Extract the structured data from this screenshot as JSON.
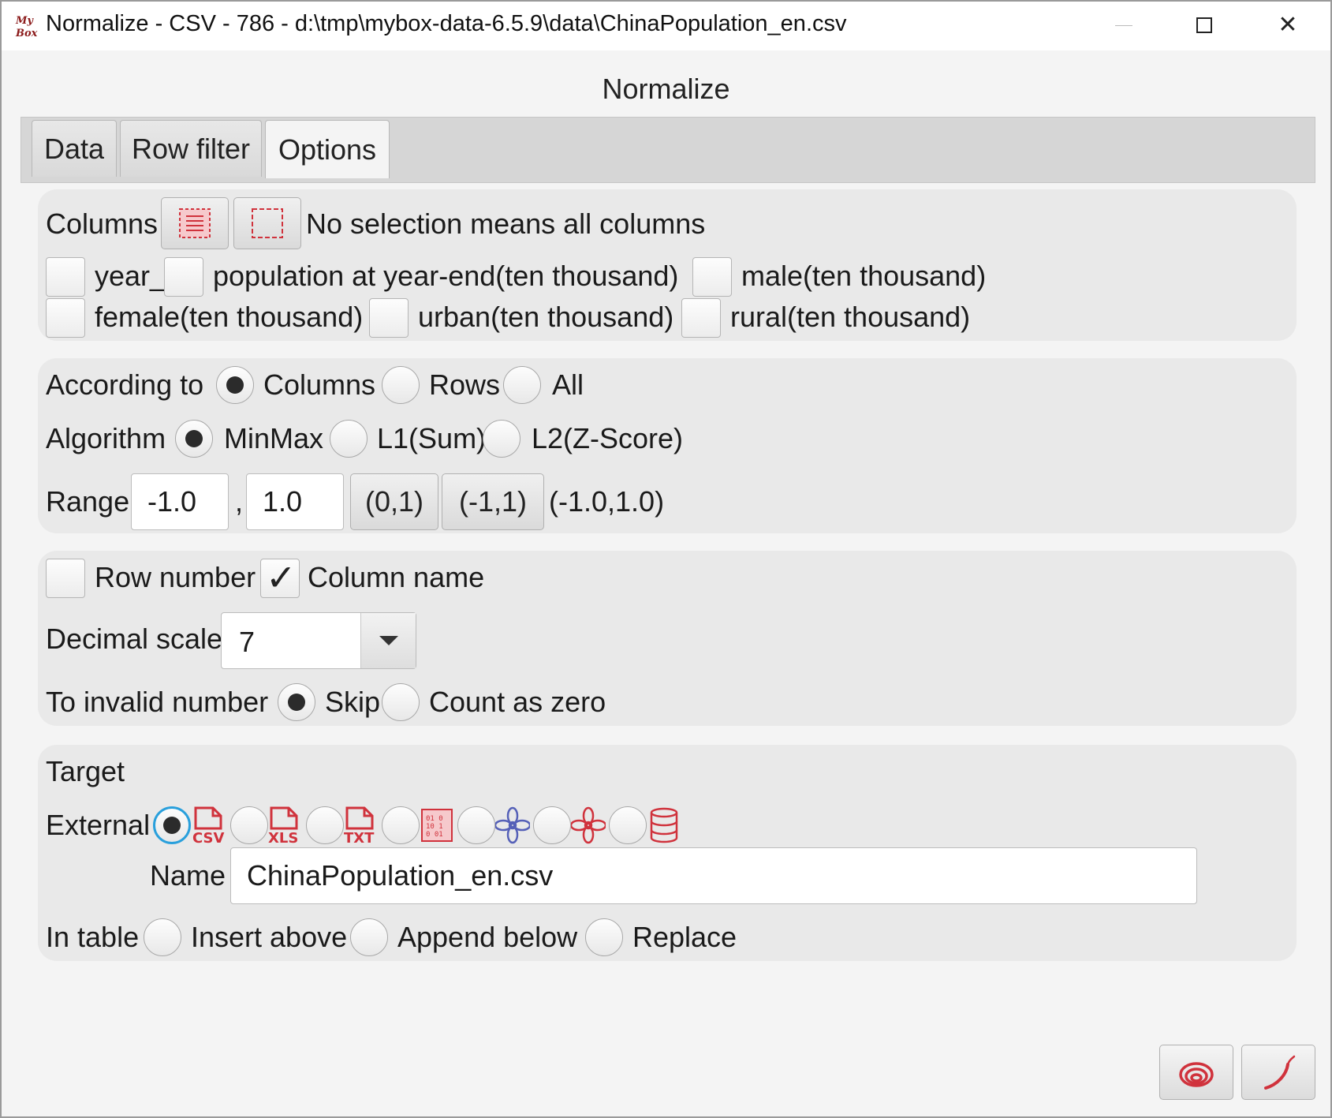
{
  "window": {
    "logo_text": "My Box",
    "title": "Normalize - CSV - 786 - d:\\tmp\\mybox-data-6.5.9\\data\\ChinaPopulation_en.csv"
  },
  "header": {
    "title": "Normalize"
  },
  "tabs": [
    {
      "label": "Data"
    },
    {
      "label": "Row filter"
    },
    {
      "label": "Options",
      "active": true
    }
  ],
  "columns": {
    "label": "Columns",
    "hint": "No selection means all columns",
    "items": [
      {
        "label": "year_",
        "checked": false
      },
      {
        "label": "population at year-end(ten thousand)",
        "checked": false
      },
      {
        "label": "male(ten thousand)",
        "checked": false
      },
      {
        "label": "female(ten thousand)",
        "checked": false
      },
      {
        "label": "urban(ten thousand)",
        "checked": false
      },
      {
        "label": "rural(ten thousand)",
        "checked": false
      }
    ]
  },
  "according": {
    "label": "According to",
    "options": [
      "Columns",
      "Rows",
      "All"
    ],
    "selected": "Columns"
  },
  "algorithm": {
    "label": "Algorithm",
    "options": [
      "MinMax",
      "L1(Sum)",
      "L2(Z-Score)"
    ],
    "selected": "MinMax"
  },
  "range": {
    "label": "Range",
    "from": "-1.0",
    "separator": ",",
    "to": "1.0",
    "preset1": "(0,1)",
    "preset2": "(-1,1)",
    "current": "(-1.0,1.0)"
  },
  "output": {
    "row_number_label": "Row number",
    "row_number_checked": false,
    "column_name_label": "Column name",
    "column_name_checked": true,
    "decimal_label": "Decimal scale",
    "decimal_value": "7",
    "invalid_label": "To invalid number",
    "invalid_options": [
      "Skip",
      "Count as zero"
    ],
    "invalid_selected": "Skip"
  },
  "target": {
    "label": "Target",
    "external_label": "External",
    "formats": [
      "csv-file-icon",
      "xls-file-icon",
      "txt-file-icon",
      "matrix-icon",
      "blue-flower-icon",
      "red-flower-icon",
      "database-icon"
    ],
    "selected_format": "csv-file-icon",
    "format_text": {
      "csv": "CSV",
      "xls": "XLS",
      "txt": "TXT"
    },
    "name_label": "Name",
    "name_value": "ChinaPopulation_en.csv",
    "in_table_label": "In table",
    "in_table_options": [
      "Insert above",
      "Append below",
      "Replace"
    ]
  },
  "colors": {
    "icon_red": "#d0323c",
    "icon_blue": "#5560b8",
    "focus": "#2aa0dc",
    "panel_bg": "#e9e9e9"
  }
}
